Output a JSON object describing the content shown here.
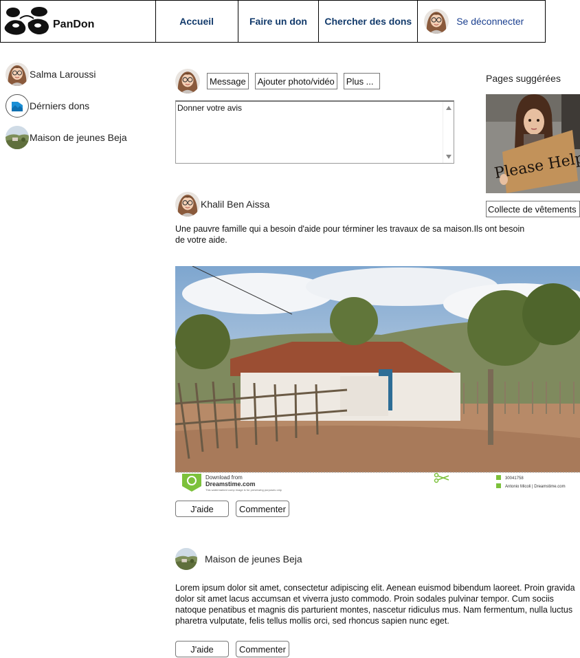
{
  "brand": {
    "name": "PanDon"
  },
  "nav": {
    "home": "Accueil",
    "donate": "Faire un don",
    "search": "Chercher des dons",
    "logout": "Se déconnecter"
  },
  "sidebar": {
    "items": [
      {
        "label": "Salma Laroussi",
        "icon": "user-avatar"
      },
      {
        "label": "Dérniers dons",
        "icon": "image-icon"
      },
      {
        "label": "Maison de jeunes Beja",
        "icon": "page-avatar"
      }
    ]
  },
  "composer": {
    "tabs": [
      "Message",
      "Ajouter photo/vidéo",
      "Plus ..."
    ],
    "textarea_value": "Donner votre avis"
  },
  "suggested": {
    "title": "Pages suggérées",
    "image_sign_text": "Please Help",
    "link_label": "Collecte de vêtements"
  },
  "posts": [
    {
      "author": "Khalil Ben Aissa",
      "text": "Une pauvre famille qui a besoin d'aide pour términer les travaux de sa maison.Ils ont besoin de votre aide.",
      "image_caption": {
        "download_from": "Download from",
        "site": "Dreamstime.com",
        "notice": "This watermarked comp image is for previewing purposes only.",
        "id": "30041758",
        "credit": "Antonio Micoli | Dreamstime.com"
      },
      "help_label": "J'aide",
      "comment_label": "Commenter"
    },
    {
      "author": "Maison de jeunes Beja",
      "text": "Lorem ipsum dolor sit amet, consectetur adipiscing elit. Aenean euismod bibendum laoreet. Proin gravida dolor sit amet lacus accumsan et viverra justo commodo. Proin sodales pulvinar tempor. Cum sociis natoque penatibus et magnis dis parturient montes, nascetur ridiculus mus. Nam fermentum, nulla luctus pharetra vulputate, felis tellus mollis orci, sed rhoncus sapien nunc eget.",
      "help_label": "J'aide",
      "comment_label": "Commenter"
    }
  ]
}
